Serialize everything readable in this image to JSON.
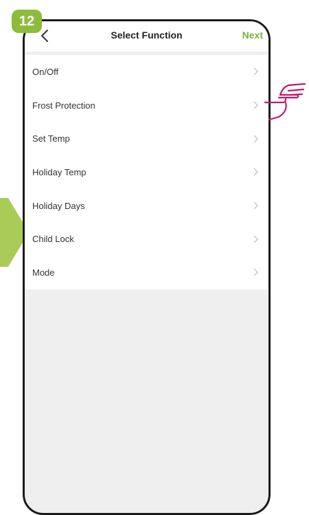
{
  "step": "12",
  "header": {
    "title": "Select Function",
    "next_label": "Next",
    "back_icon": "chevron-left-icon"
  },
  "functions": [
    {
      "label": "On/Off"
    },
    {
      "label": "Frost Protection"
    },
    {
      "label": "Set Temp"
    },
    {
      "label": "Holiday Temp"
    },
    {
      "label": "Holiday Days"
    },
    {
      "label": "Child Lock"
    },
    {
      "label": "Mode"
    }
  ],
  "colors": {
    "accent": "#8dbb3b",
    "next": "#7ab13a",
    "hand": "#c2186b"
  }
}
